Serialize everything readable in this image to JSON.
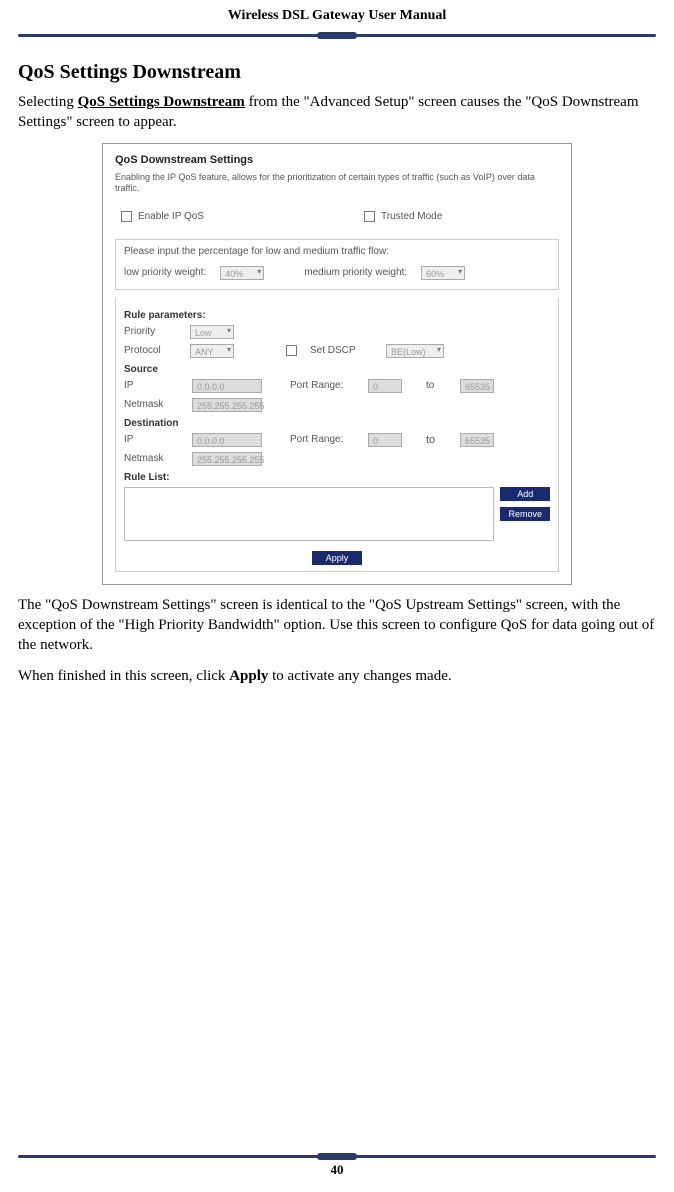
{
  "doc": {
    "header": "Wireless DSL Gateway User Manual",
    "page_number": "40",
    "section_heading": "QoS Settings Downstream",
    "intro_1a": "Selecting ",
    "intro_bold": "QoS Settings Downstream",
    "intro_1b": " from the \"Advanced Setup\" screen causes the \"QoS Downstream Settings\" screen to appear.",
    "para2": "The \"QoS Downstream Settings\" screen is identical to the \"QoS Upstream Settings\" screen, with the exception of the \"High Priority Bandwidth\" option. Use this screen to configure QoS for data going out of the network.",
    "para3a": "When finished in this screen, click ",
    "para3_bold": "Apply",
    "para3b": " to activate any changes made."
  },
  "ss": {
    "title": "QoS Downstream Settings",
    "desc": "Enabling the IP QoS feature, allows for the prioritization of certain types of traffic (such as VoIP) over data traffic.",
    "enable_label": "Enable IP QoS",
    "trusted_label": "Trusted Mode",
    "pct_prompt": "Please input the percentage for low and medium traffic flow:",
    "low_label": "low priority weight:",
    "low_val": "40%",
    "med_label": "medium priority weight:",
    "med_val": "60%",
    "rule_params": "Rule parameters:",
    "priority_label": "Priority",
    "priority_val": "Low",
    "protocol_label": "Protocol",
    "protocol_val": "ANY",
    "set_dscp_label": "Set DSCP",
    "dscp_val": "BE(Low)",
    "source_head": "Source",
    "dest_head": "Destination",
    "ip_label": "IP",
    "ip_val": "0.0.0.0",
    "netmask_label": "Netmask",
    "netmask_val": "255.255.255.255",
    "portrange_label": "Port Range:",
    "port_from": "0",
    "port_to_word": "to",
    "port_to": "65535",
    "rule_list": "Rule List:",
    "add_btn": "Add",
    "remove_btn": "Remove",
    "apply_btn": "Apply"
  }
}
